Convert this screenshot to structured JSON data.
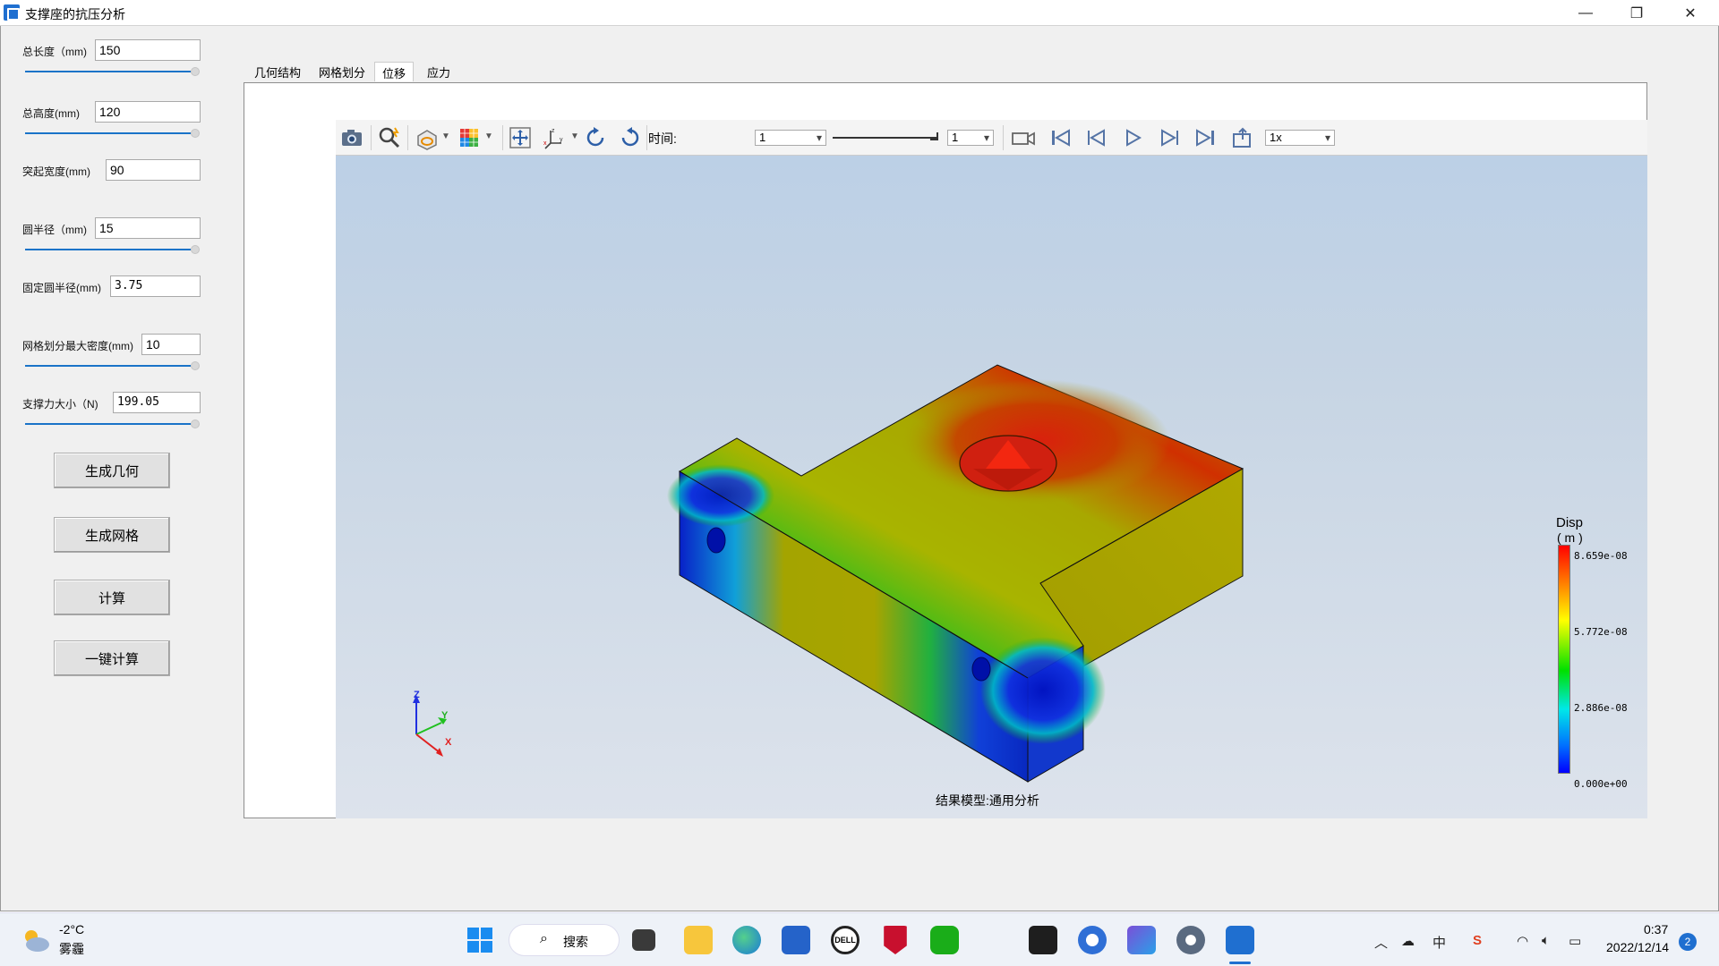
{
  "window": {
    "title": "支撑座的抗压分析",
    "minimize": "—",
    "maximize": "❐",
    "close": "✕"
  },
  "params": [
    {
      "label": "总长度（mm)",
      "value": "150",
      "slider": 1.0
    },
    {
      "label": "总高度(mm)",
      "value": "120",
      "slider": 1.0
    },
    {
      "label": "突起宽度(mm)",
      "value": "90"
    },
    {
      "label": "圆半径（mm)",
      "value": "15",
      "slider": 1.0
    },
    {
      "label": "固定圆半径(mm)",
      "value": "3.75"
    },
    {
      "label": "网格划分最大密度(mm)",
      "value": "10",
      "slider": 1.0
    },
    {
      "label": "支撑力大小（N)",
      "value": "199.05",
      "slider": 1.0
    }
  ],
  "buttons": {
    "gen_geometry": "生成几何",
    "gen_mesh": "生成网格",
    "compute": "计算",
    "one_click": "一键计算"
  },
  "tabs": [
    "几何结构",
    "网格划分",
    "位移",
    "应力"
  ],
  "active_tab": "位移",
  "toolbar": {
    "time_label": "时间:",
    "time_value": "1",
    "frame_value": "1",
    "speed_value": "1x"
  },
  "viewer": {
    "result_label": "结果模型:通用分析"
  },
  "legend": {
    "title": "Disp",
    "unit": "( m )",
    "ticks": [
      "8.659e-08",
      "5.772e-08",
      "2.886e-08",
      "0.000e+00"
    ],
    "colors": {
      "max": "#ff0000",
      "mid_high": "#ffff00",
      "mid": "#00e000",
      "mid_low": "#00e8e8",
      "min": "#0000ff"
    }
  },
  "axes": {
    "x": "X",
    "y": "Y",
    "z": "Z"
  },
  "taskbar": {
    "weather_temp": "-2°C",
    "weather_desc": "雾霾",
    "search_label": "搜索",
    "time": "0:37",
    "date": "2022/12/14",
    "notifications": "2",
    "ime": "中"
  }
}
